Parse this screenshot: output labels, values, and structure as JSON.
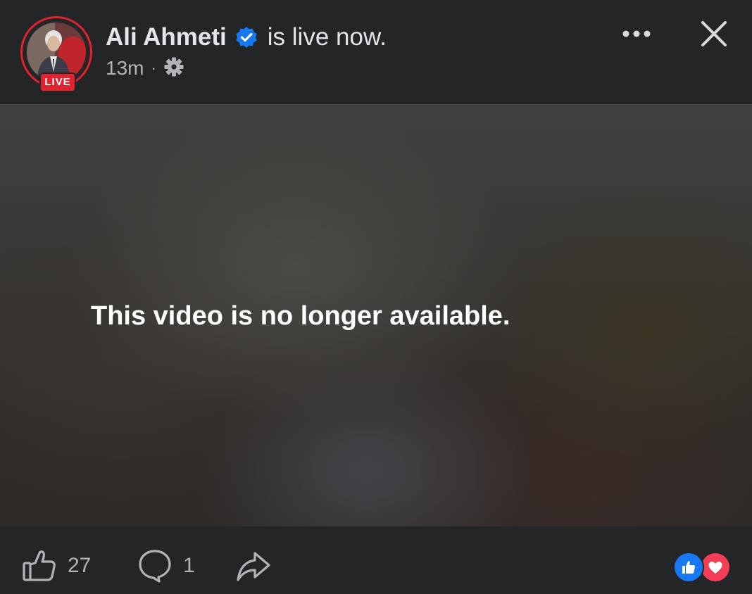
{
  "post": {
    "author_name": "Ali Ahmeti",
    "status_text": "is live now.",
    "live_badge": "LIVE",
    "time": "13m",
    "separator": "·",
    "audience_icon": "gear-icon",
    "verified_icon": "verified-badge-icon"
  },
  "video": {
    "message": "This video is no longer available."
  },
  "actions": {
    "like_count": "27",
    "comment_count": "1",
    "like_icon": "thumbs-up-icon",
    "comment_icon": "comment-bubble-icon",
    "share_icon": "share-arrow-icon"
  },
  "reactions": [
    "like",
    "love"
  ],
  "colors": {
    "background": "#242526",
    "live_red": "#e0232e",
    "verified_blue": "#1877f2",
    "like_blue": "#1877f2",
    "love_red": "#f33e58",
    "primary_text": "#e4e6eb",
    "secondary_text": "#b0b3b8"
  }
}
